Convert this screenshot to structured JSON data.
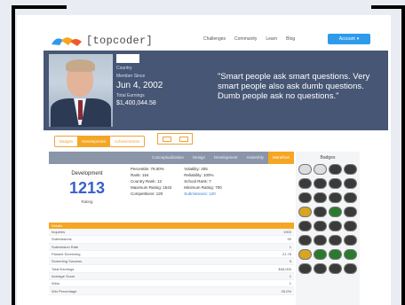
{
  "brand": {
    "logo_text": "[topcoder]",
    "colors": {
      "primary": "#2e9bea",
      "accent": "#f5a623",
      "banner": "#475674"
    }
  },
  "nav": {
    "items": [
      "Challenges",
      "Community",
      "Learn",
      "Blog"
    ]
  },
  "account": {
    "label": "Account",
    "icon": "chevron-down-icon"
  },
  "profile": {
    "country_label": "Country",
    "member_since_label": "Member Since",
    "member_since": "Jun 4, 2002",
    "total_earnings_label": "Total Earnings",
    "total_earnings": "$1,400,044.58",
    "quote": "\"Smart people ask smart questions. Very smart people also ask dumb questions. Dumb people ask no questions.\""
  },
  "tabs1": {
    "items": [
      "Badges",
      "Development",
      "Achievements"
    ],
    "active": 1
  },
  "stat_tabs": {
    "items": [
      "Conceptualization",
      "Design",
      "Development",
      "Assembly",
      "Marathon"
    ],
    "active": 4
  },
  "rating": {
    "label": "Development",
    "value": "1213",
    "sub": "Rating"
  },
  "stats": {
    "col1": [
      "Percentile: 79.00%",
      "Rank: 154",
      "Country Rank: 12",
      "Maximum Rating: 1542",
      "Competitions: 120"
    ],
    "col2": [
      "Volatility: 405",
      "Reliability: 100%",
      "School Rank: 7",
      "Minimum Rating: 700",
      "Submissions: 120"
    ]
  },
  "table": {
    "header": "Details",
    "rows": [
      {
        "label": "Inquiries",
        "value": "1900"
      },
      {
        "label": "Submissions",
        "value": "90"
      },
      {
        "label": "Submission Rate",
        "value": "1"
      },
      {
        "label": "Passed Screening",
        "value": "21.78"
      },
      {
        "label": "Screening Success",
        "value": "5"
      },
      {
        "label": "Total Earnings",
        "value": "$45,000"
      },
      {
        "label": "Average Score",
        "value": "1"
      },
      {
        "label": "Wins",
        "value": "1"
      },
      {
        "label": "Win Percentage",
        "value": "25.0%"
      }
    ]
  },
  "badges": {
    "title": "Badges"
  }
}
